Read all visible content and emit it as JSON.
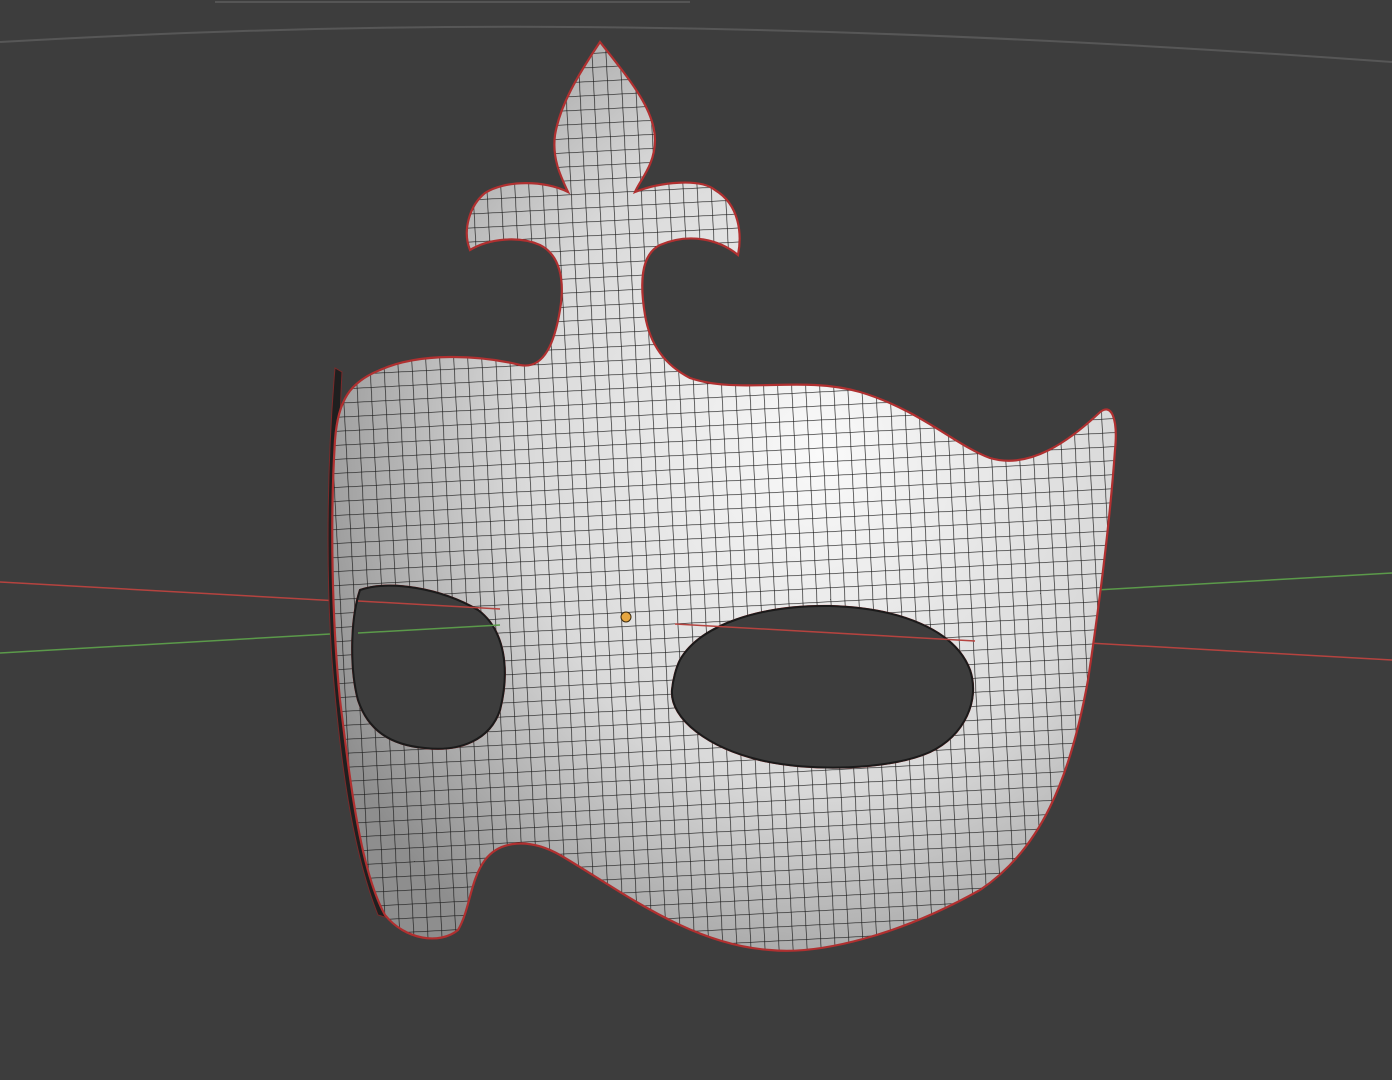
{
  "viewport": {
    "background": "#3d3d3d",
    "axis_x_color": "#b5433f",
    "axis_y_color": "#5b9a4a",
    "grid_color": "#5a5a5a"
  },
  "object": {
    "kind": "mask-mesh",
    "fill": "#e6e6e6",
    "wire_color": "#1a1a1a",
    "outline_color": "#b03030"
  },
  "origin": {
    "color": "#e6a640"
  }
}
